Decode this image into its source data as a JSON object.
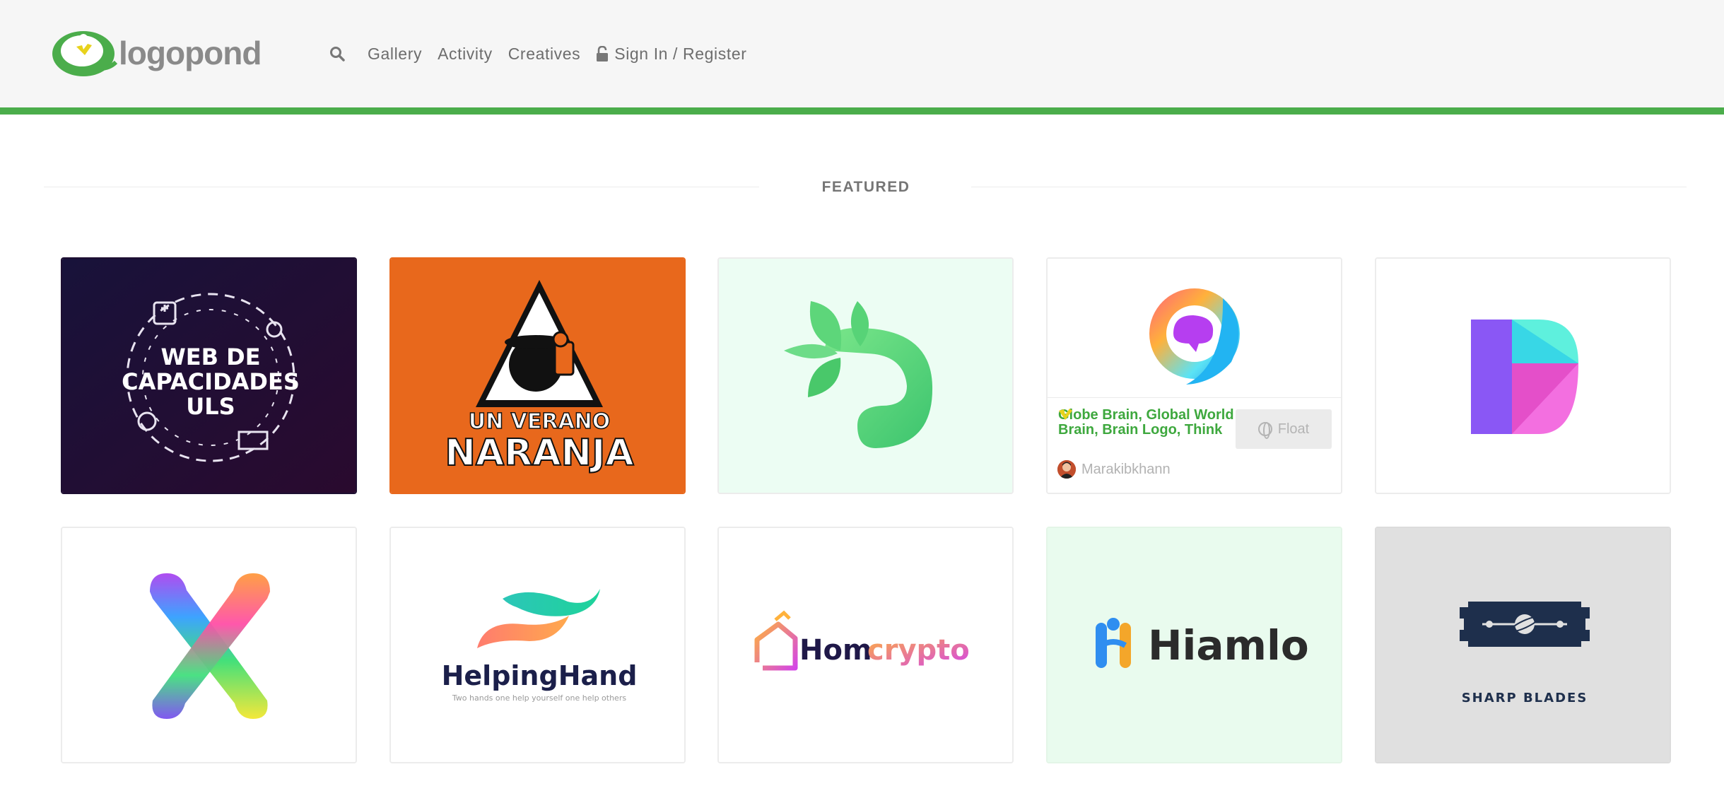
{
  "header": {
    "logo_text": "logopond",
    "nav": [
      {
        "label": "Gallery"
      },
      {
        "label": "Activity"
      },
      {
        "label": "Creatives"
      },
      {
        "label": "Sign In / Register"
      }
    ]
  },
  "section": {
    "title": "FEATURED"
  },
  "cards": [
    {
      "logo_text_1": "WEB DE",
      "logo_text_2": "CAPACIDADES",
      "logo_text_3": "ULS",
      "bg": "#1e0f32"
    },
    {
      "logo_text_1": "UN VERANO",
      "logo_text_2": "NARANJA",
      "bg": "#e8681c"
    },
    {
      "bg": "#ecfdf3"
    },
    {
      "bg": "#ffffff",
      "title": "Globe Brain, Global World Brain, Brain Logo, Think",
      "author": "Marakibkhann",
      "float_label": "Float"
    },
    {
      "bg": "#ffffff"
    },
    {
      "bg": "#ffffff"
    },
    {
      "logo_text_1": "HelpingHand",
      "logo_text_2": "Two hands one help yourself one help others",
      "bg": "#ffffff"
    },
    {
      "logo_text_1": "Hom",
      "logo_text_2": "crypto",
      "bg": "#ffffff"
    },
    {
      "logo_text_1": "Hiamlo",
      "bg": "#e9fbee"
    },
    {
      "logo_text_1": "SHARP BLADES",
      "bg": "#e0e0e0"
    }
  ],
  "colors": {
    "brand_green": "#4bad4b",
    "title_green": "#3ea83e",
    "nav_text": "#6d6d6d"
  },
  "icons": [
    "search-icon",
    "lock-icon",
    "globe-icon",
    "lotus-icon"
  ]
}
